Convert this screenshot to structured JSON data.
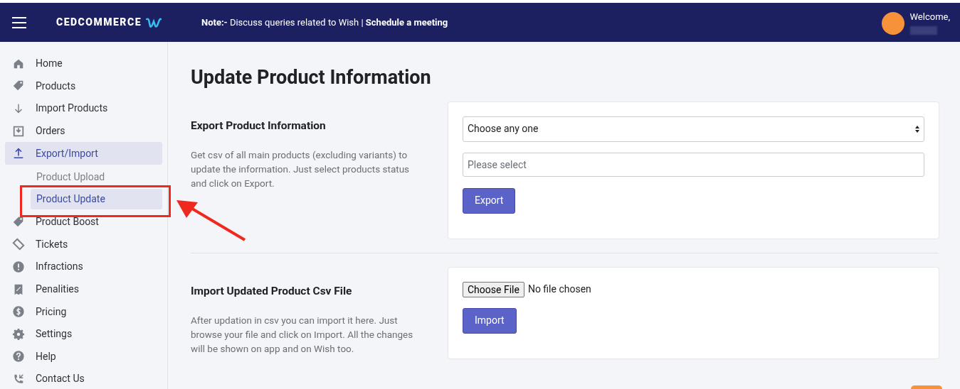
{
  "header": {
    "logo": "CEDCOMMERCE",
    "note_label": "Note:-",
    "note_text": " Discuss queries related to Wish | ",
    "note_link": "Schedule a meeting",
    "welcome": "Welcome,"
  },
  "sidebar": {
    "items": [
      {
        "label": "Home",
        "selected": false
      },
      {
        "label": "Products",
        "selected": false
      },
      {
        "label": "Import Products",
        "selected": false
      },
      {
        "label": "Orders",
        "selected": false
      },
      {
        "label": "Export/Import",
        "selected": true,
        "expanded": true,
        "children": [
          {
            "label": "Product Upload",
            "selected": false
          },
          {
            "label": "Product Update",
            "selected": true
          }
        ]
      },
      {
        "label": "Product Boost",
        "selected": false
      },
      {
        "label": "Tickets",
        "selected": false
      },
      {
        "label": "Infractions",
        "selected": false
      },
      {
        "label": "Penalities",
        "selected": false
      },
      {
        "label": "Pricing",
        "selected": false
      },
      {
        "label": "Settings",
        "selected": false
      },
      {
        "label": "Help",
        "selected": false
      },
      {
        "label": "Contact Us",
        "selected": false
      }
    ]
  },
  "page": {
    "title": "Update Product Information",
    "sections": [
      {
        "kind": "export",
        "heading": "Export Product Information",
        "description": "Get csv of all main products (excluding variants) to update the information. Just select products status and click on Export.",
        "select": {
          "value": "Choose any one"
        },
        "input": {
          "placeholder": "Please select"
        },
        "button": "Export"
      },
      {
        "kind": "import",
        "heading": "Import Updated Product Csv File",
        "description": "After updation in csv you can import it here. Just browse your file and click on Import. All the changes will be shown on app and on Wish too.",
        "file_button": "Choose File",
        "file_status": "No file chosen",
        "button": "Import"
      }
    ]
  }
}
